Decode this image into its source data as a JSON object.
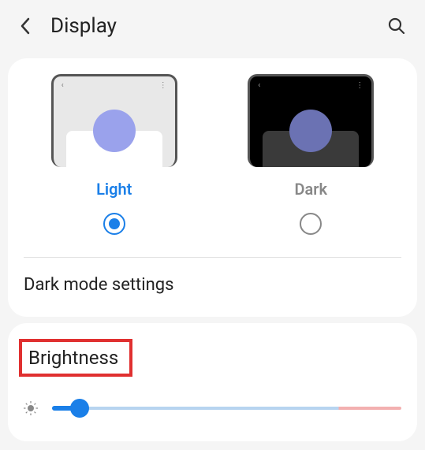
{
  "header": {
    "title": "Display"
  },
  "theme": {
    "light_label": "Light",
    "dark_label": "Dark",
    "selected": "light"
  },
  "settings": {
    "dark_mode_link": "Dark mode settings"
  },
  "brightness": {
    "title": "Brightness",
    "value_percent": 8
  },
  "icons": {
    "back": "back-icon",
    "search": "search-icon",
    "brightness": "brightness-icon"
  }
}
